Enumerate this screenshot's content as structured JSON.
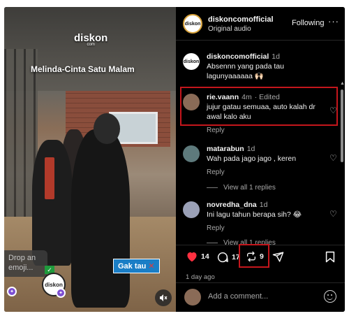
{
  "video": {
    "brand_logo": "diskon",
    "brand_logo_sub": "com",
    "caption": "Melinda-Cinta Satu Malam",
    "badge_text": "Gak tau",
    "badge_mark": "✕",
    "drop_emoji_text": "Drop an emoji..."
  },
  "post": {
    "username": "diskoncomofficial",
    "audio": "Original audio",
    "follow_label": "Following",
    "more_label": "···"
  },
  "comments": [
    {
      "username": "diskoncomofficial",
      "time": "1d",
      "edited": "",
      "text": "Absennn yang pada tau lagunyaaaaaa 🙌🏻",
      "reply_label": "",
      "view_replies": ""
    },
    {
      "username": "rie.vaann",
      "time": "4m",
      "edited": "· Edited",
      "text": "jujur gatau semuaa, auto kalah dr awal kalo aku",
      "reply_label": "Reply",
      "view_replies": ""
    },
    {
      "username": "matarabun",
      "time": "1d",
      "edited": "",
      "text": "Wah pada jago jago , keren",
      "reply_label": "Reply",
      "view_replies": "View all 1 replies"
    },
    {
      "username": "novredha_dna",
      "time": "1d",
      "edited": "",
      "text": "Ini lagu tahun berapa sih? 😂",
      "reply_label": "Reply",
      "view_replies": "View all 1 replies"
    }
  ],
  "actions": {
    "likes": "14",
    "comments_count": "17",
    "reposts": "9",
    "date_ago": "1 day ago"
  },
  "add_comment": {
    "placeholder": "Add a comment..."
  },
  "colors": {
    "highlight": "#c4161c",
    "like_red": "#ff3040",
    "badge_blue": "#1a7ec6"
  }
}
